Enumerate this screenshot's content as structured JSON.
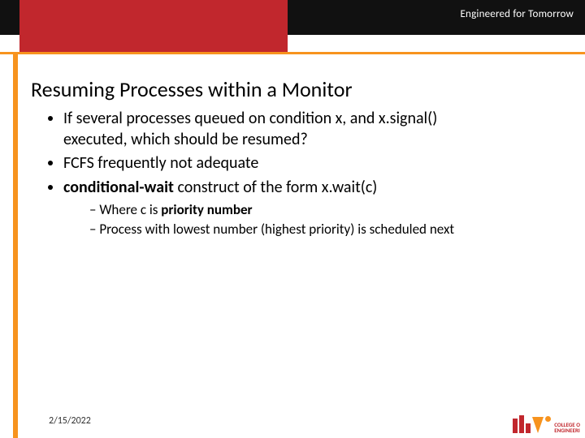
{
  "header": {
    "tagline": "Engineered for Tomorrow"
  },
  "title": "Resuming Processes within a Monitor",
  "bullets": {
    "b1_part1": "If several processes queued on condition x, and x.signal()",
    "b1_part2": "executed, which should be resumed?",
    "b2": "FCFS frequently not adequate",
    "b3_bold": "conditional-wait",
    "b3_rest": " construct of the form x.wait(c)",
    "s1_pre": "Where c is ",
    "s1_bold": "priority number",
    "s2": "Process with lowest number (highest priority) is scheduled next"
  },
  "footer": {
    "date": "2/15/2022",
    "logo_line1": "COLLEGE O",
    "logo_line2": "ENGINEERI"
  }
}
